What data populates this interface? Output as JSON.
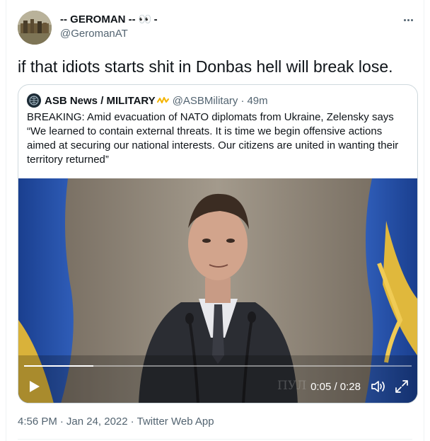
{
  "author": {
    "display_name": "-- GEROMAN -- ",
    "name_emoji": "👀",
    "name_suffix": " -",
    "handle": "@GeromanAT"
  },
  "tweet": {
    "text": "if that idiots starts shit in Donbas hell will break lose."
  },
  "quote": {
    "display_name": "ASB News / MILITARY",
    "handle": "@ASBMilitary",
    "separator": "·",
    "age": "49m",
    "text": "BREAKING: Amid evacuation of NATO diplomats from Ukraine,  Zelensky says “We learned to contain external threats. It is time we begin offensive actions aimed at securing our national interests. Our citizens are united in wanting their territory returned”"
  },
  "video": {
    "elapsed": "0:05",
    "duration": "0:28",
    "time_display": "0:05 / 0:28",
    "progress": 0.179,
    "watermark": "ПУЛ"
  },
  "footer": {
    "time": "4:56 PM",
    "date": "Jan 24, 2022",
    "source": "Twitter Web App",
    "separator": "·"
  },
  "colors": {
    "text_primary": "#0f1419",
    "text_secondary": "#536471",
    "border": "#cfd9de",
    "badge": "#f4b400"
  },
  "icons": {
    "more": "more-horizontal-icon",
    "badge": "signal-wave-icon",
    "play": "play-icon",
    "volume": "volume-icon",
    "fullscreen": "fullscreen-icon"
  }
}
